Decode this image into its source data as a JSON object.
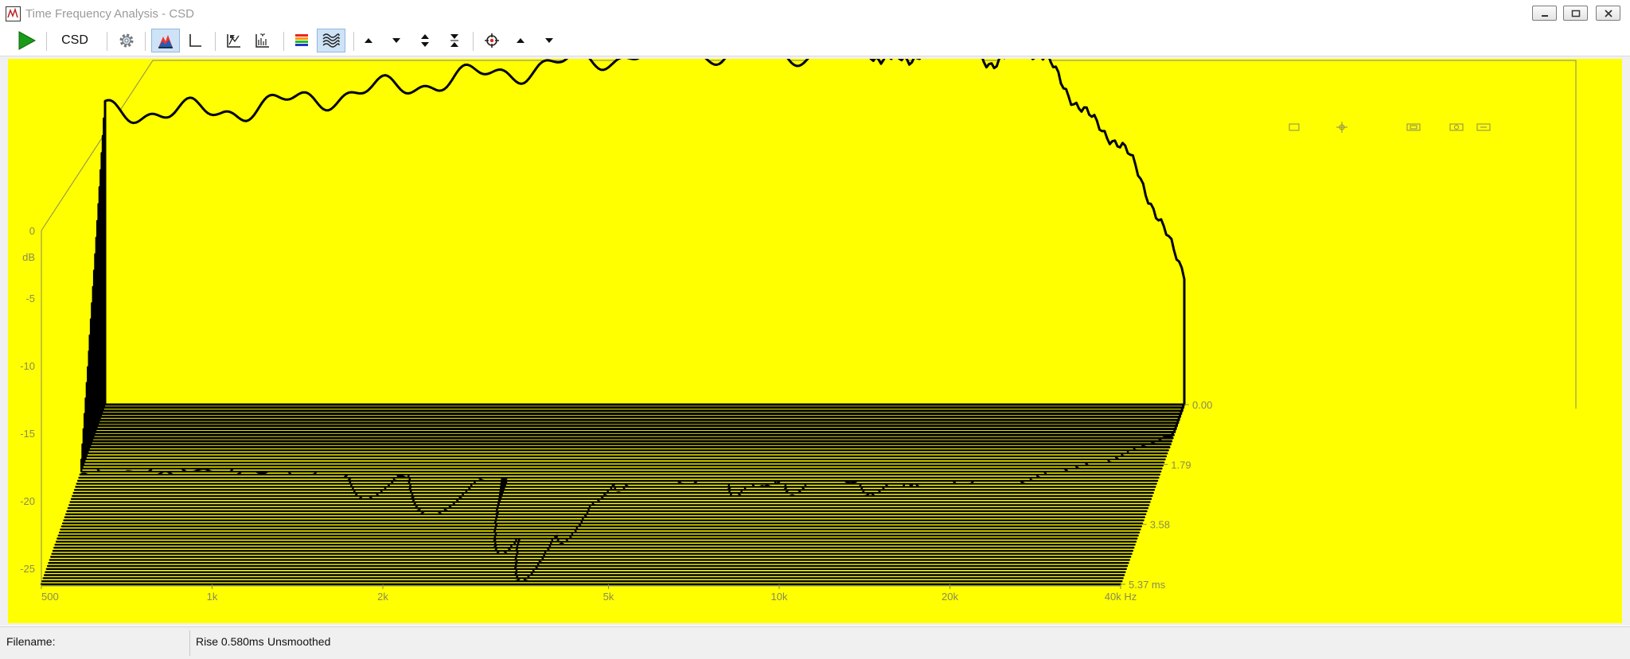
{
  "window": {
    "title": "Time Frequency Analysis - CSD"
  },
  "toolbar": {
    "csd_label": "CSD"
  },
  "icons": {
    "app": "app-icon",
    "play": "play-icon",
    "settings": "gear-icon",
    "waterfall": "waterfall-icon",
    "axis": "axis-icon",
    "peak_flag": "peak-flag-icon",
    "ms_flag": "ms-flag-icon",
    "color_scale": "color-scale-icon",
    "wave_style": "wave-icon",
    "up": "arrow-up-icon",
    "down": "arrow-down-icon",
    "expand": "expand-icon",
    "compress": "compress-icon",
    "target": "crosshair-icon"
  },
  "colors": {
    "plot_bg": "#ffff00",
    "trace": "#000000",
    "axis_label": "#8a8a5a",
    "play": "#1a9a1a"
  },
  "chart_data": {
    "type": "area",
    "style": "3D waterfall (cumulative spectral decay)",
    "x_scale": "log",
    "x_ticks": [
      "500",
      "1k",
      "2k",
      "5k",
      "10k",
      "20k",
      "40k Hz"
    ],
    "y_ticks": [
      "0",
      "-5",
      "-10",
      "-15",
      "-20",
      "-25"
    ],
    "y_unit": "dB",
    "z_ticks": [
      "0.00",
      "1.79",
      "3.58",
      "5.37 ms"
    ],
    "xlim_hz": [
      500,
      40000
    ],
    "ylim_db": [
      -25,
      0
    ],
    "zlim_ms": [
      0,
      5.37
    ],
    "slice_count": 60
  },
  "status": {
    "filename": "Filename:",
    "rise": "Rise 0.580ms",
    "smoothing": "Unsmoothed"
  }
}
